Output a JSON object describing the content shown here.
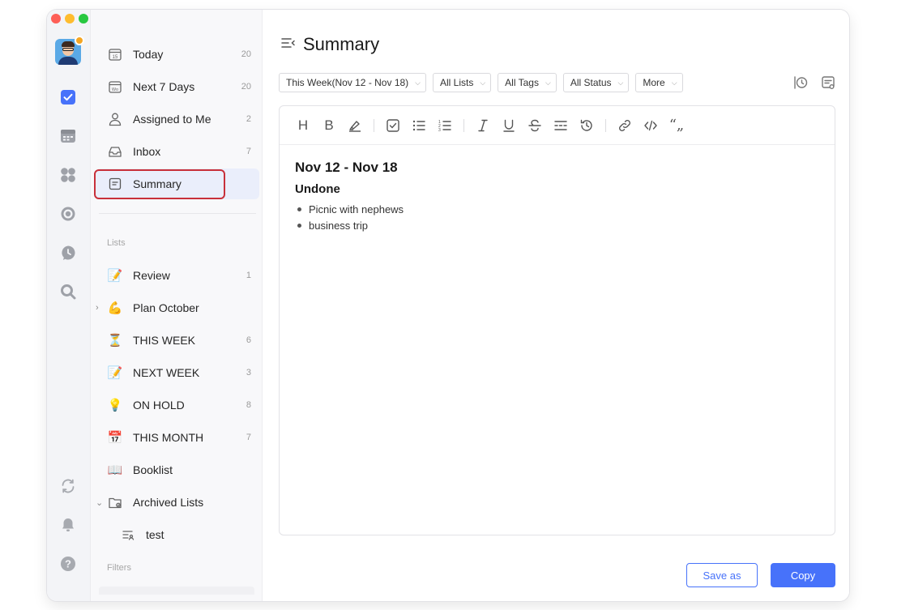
{
  "colors": {
    "accent": "#4772fa",
    "highlight": "#c8303a",
    "active_bg": "#eaeefb"
  },
  "rail": {
    "icons": [
      "checkbox-icon",
      "calendar-icon",
      "grid-icon",
      "focus-icon",
      "clock-icon",
      "search-icon",
      "sync-icon",
      "bell-icon",
      "help-icon"
    ]
  },
  "sidebar": {
    "smart_lists": [
      {
        "label": "Today",
        "count": "20",
        "icon": "calendar-day-icon"
      },
      {
        "label": "Next 7 Days",
        "count": "20",
        "icon": "calendar-week-icon"
      },
      {
        "label": "Assigned to Me",
        "count": "2",
        "icon": "user-icon"
      },
      {
        "label": "Inbox",
        "count": "7",
        "icon": "inbox-icon"
      },
      {
        "label": "Summary",
        "count": "",
        "icon": "summary-icon"
      }
    ],
    "lists_label": "Lists",
    "lists": [
      {
        "label": "Review",
        "count": "1",
        "emoji": "📝"
      },
      {
        "label": "Plan October",
        "count": "",
        "emoji": "💪"
      },
      {
        "label": "THIS WEEK",
        "count": "6",
        "emoji": "⏳"
      },
      {
        "label": "NEXT WEEK",
        "count": "3",
        "emoji": "📝"
      },
      {
        "label": "ON HOLD",
        "count": "8",
        "emoji": "💡"
      },
      {
        "label": "THIS MONTH",
        "count": "7",
        "emoji": "📅"
      },
      {
        "label": "Booklist",
        "count": "",
        "emoji": "📖"
      },
      {
        "label": "Archived Lists",
        "count": "",
        "emoji": ""
      },
      {
        "label": "test",
        "count": "",
        "emoji": ""
      }
    ],
    "filters_label": "Filters"
  },
  "main": {
    "title": "Summary",
    "filters": [
      {
        "label": "This Week(Nov 12 - Nov 18)"
      },
      {
        "label": "All Lists"
      },
      {
        "label": "All Tags"
      },
      {
        "label": "All Status"
      },
      {
        "label": "More"
      }
    ],
    "editor": {
      "date_heading": "Nov 12 - Nov 18",
      "section_heading": "Undone",
      "items": [
        "Picnic with nephews",
        "business trip"
      ]
    },
    "buttons": {
      "save_as": "Save as",
      "copy": "Copy"
    }
  }
}
